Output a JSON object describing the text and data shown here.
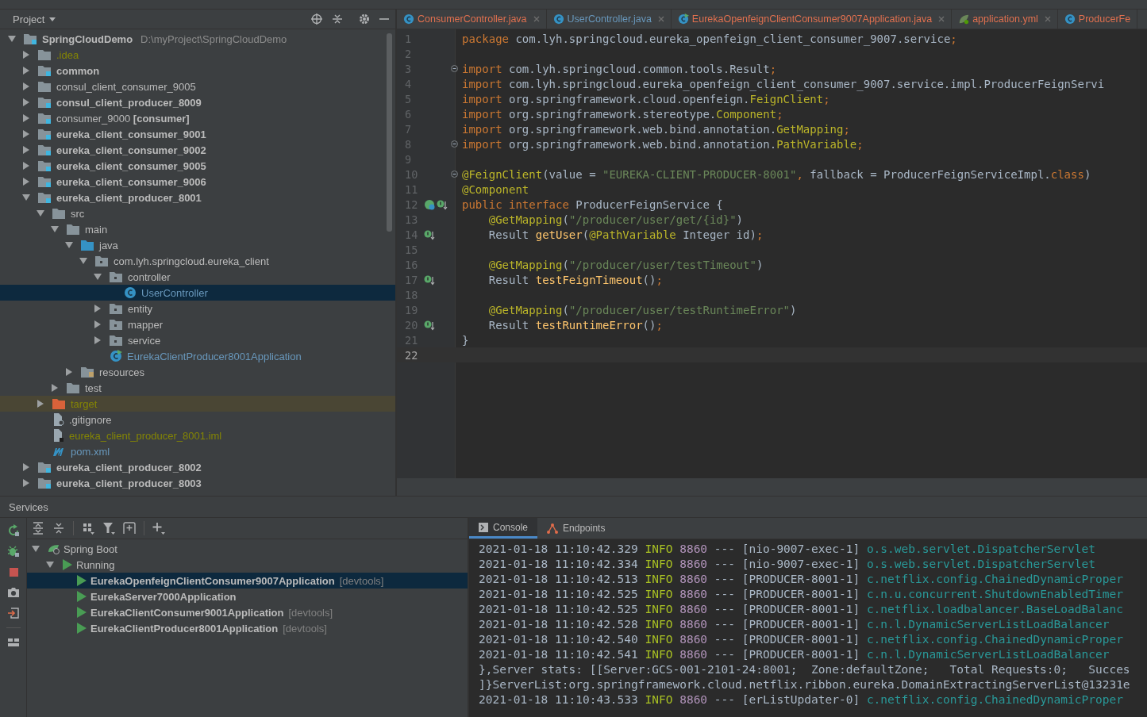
{
  "project_panel": {
    "title": "Project",
    "tree": [
      {
        "name": "SpringCloudDemo",
        "path": "D:\\myProject\\SpringCloudDemo",
        "kind": "module",
        "bold": true,
        "color": "#bbbbbb",
        "expanded": true,
        "selected": false,
        "children": [
          {
            "name": ".idea",
            "kind": "folder",
            "bold": false,
            "color": "#848504",
            "expanded": false,
            "selected": false
          },
          {
            "name": "common",
            "kind": "module",
            "bold": true,
            "color": "#bbbbbb",
            "expanded": false,
            "selected": false
          },
          {
            "name": "consul_client_consumer_9005",
            "kind": "folder",
            "bold": false,
            "color": "#bbbbbb",
            "expanded": false,
            "selected": false
          },
          {
            "name": "consul_client_producer_8009",
            "kind": "module",
            "bold": true,
            "color": "#bbbbbb",
            "expanded": false,
            "selected": false
          },
          {
            "name": "consumer_9000 **[consumer]**",
            "kind": "module",
            "bold": false,
            "color": "#bbbbbb",
            "expanded": false,
            "selected": false
          },
          {
            "name": "eureka_client_consumer_9001",
            "kind": "module",
            "bold": true,
            "color": "#bbbbbb",
            "expanded": false,
            "selected": false
          },
          {
            "name": "eureka_client_consumer_9002",
            "kind": "module",
            "bold": true,
            "color": "#bbbbbb",
            "expanded": false,
            "selected": false
          },
          {
            "name": "eureka_client_consumer_9005",
            "kind": "module",
            "bold": true,
            "color": "#bbbbbb",
            "expanded": false,
            "selected": false
          },
          {
            "name": "eureka_client_consumer_9006",
            "kind": "module",
            "bold": true,
            "color": "#bbbbbb",
            "expanded": false,
            "selected": false
          },
          {
            "name": "eureka_client_producer_8001",
            "kind": "module",
            "bold": true,
            "color": "#bbbbbb",
            "expanded": true,
            "selected": false,
            "children": [
              {
                "name": "src",
                "kind": "folder",
                "bold": false,
                "color": "#bbbbbb",
                "expanded": true,
                "selected": false,
                "children": [
                  {
                    "name": "main",
                    "kind": "folder",
                    "bold": false,
                    "color": "#bbbbbb",
                    "expanded": true,
                    "selected": false,
                    "children": [
                      {
                        "name": "java",
                        "kind": "source-folder",
                        "bold": false,
                        "color": "#bbbbbb",
                        "expanded": true,
                        "selected": false,
                        "children": [
                          {
                            "name": "com.lyh.springcloud.eureka_client",
                            "kind": "package",
                            "bold": false,
                            "color": "#bbbbbb",
                            "expanded": true,
                            "selected": false,
                            "children": [
                              {
                                "name": "controller",
                                "kind": "package",
                                "bold": false,
                                "color": "#bbbbbb",
                                "expanded": true,
                                "selected": false,
                                "children": [
                                  {
                                    "name": "UserController",
                                    "kind": "class",
                                    "bold": false,
                                    "color": "#6897bb",
                                    "selected": true
                                  }
                                ]
                              },
                              {
                                "name": "entity",
                                "kind": "package",
                                "bold": false,
                                "color": "#bbbbbb",
                                "expanded": false,
                                "selected": false
                              },
                              {
                                "name": "mapper",
                                "kind": "package",
                                "bold": false,
                                "color": "#bbbbbb",
                                "expanded": false,
                                "selected": false
                              },
                              {
                                "name": "service",
                                "kind": "package",
                                "bold": false,
                                "color": "#bbbbbb",
                                "expanded": false,
                                "selected": false
                              },
                              {
                                "name": "EurekaClientProducer8001Application",
                                "kind": "app-class",
                                "bold": false,
                                "color": "#6897bb",
                                "selected": false
                              }
                            ]
                          }
                        ]
                      },
                      {
                        "name": "resources",
                        "kind": "resource-folder",
                        "bold": false,
                        "color": "#bbbbbb",
                        "expanded": false,
                        "selected": false
                      }
                    ]
                  },
                  {
                    "name": "test",
                    "kind": "folder",
                    "bold": false,
                    "color": "#bbbbbb",
                    "expanded": false,
                    "selected": false
                  }
                ]
              },
              {
                "name": "target",
                "kind": "excluded-folder",
                "bold": false,
                "color": "#848504",
                "expanded": false,
                "selected": false
              },
              {
                "name": ".gitignore",
                "kind": "ignore-file",
                "bold": false,
                "color": "#bbbbbb",
                "selected": false
              },
              {
                "name": "eureka_client_producer_8001.iml",
                "kind": "module-file",
                "bold": false,
                "color": "#848504",
                "selected": false
              },
              {
                "name": "pom.xml",
                "kind": "maven-file",
                "bold": false,
                "color": "#6897bb",
                "selected": false
              }
            ]
          },
          {
            "name": "eureka_client_producer_8002",
            "kind": "module",
            "bold": true,
            "color": "#bbbbbb",
            "expanded": false,
            "selected": false
          },
          {
            "name": "eureka_client_producer_8003",
            "kind": "module",
            "bold": true,
            "color": "#bbbbbb",
            "expanded": false,
            "selected": false
          }
        ]
      }
    ]
  },
  "editor": {
    "tabs": [
      {
        "label": "ConsumerController.java",
        "kind": "class",
        "color": "#e0704f",
        "closable": true
      },
      {
        "label": "UserController.java",
        "kind": "class",
        "color": "#6897bb",
        "closable": true
      },
      {
        "label": "EurekaOpenfeignClientConsumer9007Application.java",
        "kind": "app-class",
        "color": "#e0704f",
        "closable": true
      },
      {
        "label": "application.yml",
        "kind": "yml",
        "color": "#e0704f",
        "closable": true
      },
      {
        "label": "ProducerFe",
        "kind": "class",
        "color": "#e0704f",
        "closable": false
      }
    ],
    "lines": [
      {
        "num": "1",
        "fold": false,
        "kind": "plain",
        "current": false,
        "tokens": [
          {
            "kind": "kw",
            "text": "package"
          },
          {
            "kind": "p",
            "text": " com.lyh.springcloud.eureka_openfeign_client_consumer_9007.service"
          },
          {
            "kind": "kw",
            "text": ";"
          }
        ]
      },
      {
        "num": "2",
        "fold": false,
        "kind": "plain",
        "current": false
      },
      {
        "num": "3",
        "fold": true,
        "kind": "plain",
        "current": false,
        "tokens": [
          {
            "kind": "kw",
            "text": "import"
          },
          {
            "kind": "p",
            "text": " com.lyh.springcloud.common.tools.Result"
          },
          {
            "kind": "kw",
            "text": ";"
          }
        ]
      },
      {
        "num": "4",
        "fold": false,
        "kind": "plain",
        "current": false,
        "tokens": [
          {
            "kind": "kw",
            "text": "import"
          },
          {
            "kind": "p",
            "text": " com.lyh.springcloud.eureka_openfeign_client_consumer_9007.service.impl.ProducerFeignServi"
          }
        ]
      },
      {
        "num": "5",
        "fold": false,
        "kind": "plain",
        "current": false,
        "tokens": [
          {
            "kind": "kw",
            "text": "import"
          },
          {
            "kind": "p",
            "text": " org.springframework.cloud.openfeign."
          },
          {
            "kind": "ann",
            "text": "FeignClient"
          },
          {
            "kind": "kw",
            "text": ";"
          }
        ]
      },
      {
        "num": "6",
        "fold": false,
        "kind": "plain",
        "current": false,
        "tokens": [
          {
            "kind": "kw",
            "text": "import"
          },
          {
            "kind": "p",
            "text": " org.springframework.stereotype."
          },
          {
            "kind": "ann",
            "text": "Component"
          },
          {
            "kind": "kw",
            "text": ";"
          }
        ]
      },
      {
        "num": "7",
        "fold": false,
        "kind": "plain",
        "current": false,
        "tokens": [
          {
            "kind": "kw",
            "text": "import"
          },
          {
            "kind": "p",
            "text": " org.springframework.web.bind.annotation."
          },
          {
            "kind": "ann",
            "text": "GetMapping"
          },
          {
            "kind": "kw",
            "text": ";"
          }
        ]
      },
      {
        "num": "8",
        "fold": true,
        "kind": "plain",
        "current": false,
        "tokens": [
          {
            "kind": "kw",
            "text": "import"
          },
          {
            "kind": "p",
            "text": " org.springframework.web.bind.annotation."
          },
          {
            "kind": "ann",
            "text": "PathVariable"
          },
          {
            "kind": "kw",
            "text": ";"
          }
        ]
      },
      {
        "num": "9",
        "fold": false,
        "kind": "plain",
        "current": false
      },
      {
        "num": "10",
        "fold": true,
        "kind": "plain",
        "current": false,
        "tokens": [
          {
            "kind": "ann",
            "text": "@FeignClient"
          },
          {
            "kind": "p",
            "text": "(value = "
          },
          {
            "kind": "str",
            "text": "\"EUREKA-CLIENT-PRODUCER-8001\""
          },
          {
            "kind": "kw",
            "text": ", "
          },
          {
            "kind": "p",
            "text": "fallback = ProducerFeignServiceImpl."
          },
          {
            "kind": "kw",
            "text": "class"
          },
          {
            "kind": "p",
            "text": ")"
          }
        ]
      },
      {
        "num": "11",
        "fold": false,
        "kind": "plain",
        "current": false,
        "tokens": [
          {
            "kind": "ann",
            "text": "@Component"
          }
        ]
      },
      {
        "num": "12",
        "fold": false,
        "kind": "interface",
        "current": false,
        "tokens": [
          {
            "kind": "kw",
            "text": "public interface"
          },
          {
            "kind": "p",
            "text": " ProducerFeignService {"
          }
        ]
      },
      {
        "num": "13",
        "fold": false,
        "kind": "plain",
        "current": false,
        "tokens": [
          {
            "kind": "ann",
            "text": "    @GetMapping"
          },
          {
            "kind": "p",
            "text": "("
          },
          {
            "kind": "str",
            "text": "\"/producer/user/get/{id}\""
          },
          {
            "kind": "p",
            "text": ")"
          }
        ]
      },
      {
        "num": "14",
        "fold": false,
        "kind": "method",
        "current": false,
        "tokens": [
          {
            "kind": "p",
            "text": "    Result "
          },
          {
            "kind": "fn",
            "text": "getUser"
          },
          {
            "kind": "p",
            "text": "("
          },
          {
            "kind": "ann",
            "text": "@PathVariable"
          },
          {
            "kind": "p",
            "text": " Integer id)"
          },
          {
            "kind": "kw",
            "text": ";"
          }
        ]
      },
      {
        "num": "15",
        "fold": false,
        "kind": "plain",
        "current": false
      },
      {
        "num": "16",
        "fold": false,
        "kind": "plain",
        "current": false,
        "tokens": [
          {
            "kind": "ann",
            "text": "    @GetMapping"
          },
          {
            "kind": "p",
            "text": "("
          },
          {
            "kind": "str",
            "text": "\"/producer/user/testTimeout\""
          },
          {
            "kind": "p",
            "text": ")"
          }
        ]
      },
      {
        "num": "17",
        "fold": false,
        "kind": "method",
        "current": false,
        "tokens": [
          {
            "kind": "p",
            "text": "    Result "
          },
          {
            "kind": "fn",
            "text": "testFeignTimeout"
          },
          {
            "kind": "p",
            "text": "()"
          },
          {
            "kind": "kw",
            "text": ";"
          }
        ]
      },
      {
        "num": "18",
        "fold": false,
        "kind": "plain",
        "current": false
      },
      {
        "num": "19",
        "fold": false,
        "kind": "plain",
        "current": false,
        "tokens": [
          {
            "kind": "ann",
            "text": "    @GetMapping"
          },
          {
            "kind": "p",
            "text": "("
          },
          {
            "kind": "str",
            "text": "\"/producer/user/testRuntimeError\""
          },
          {
            "kind": "p",
            "text": ")"
          }
        ]
      },
      {
        "num": "20",
        "fold": false,
        "kind": "method",
        "current": false,
        "tokens": [
          {
            "kind": "p",
            "text": "    Result "
          },
          {
            "kind": "fn",
            "text": "testRuntimeError"
          },
          {
            "kind": "p",
            "text": "()"
          },
          {
            "kind": "kw",
            "text": ";"
          }
        ]
      },
      {
        "num": "21",
        "fold": false,
        "kind": "plain",
        "current": false,
        "tokens": [
          {
            "kind": "p",
            "text": "}"
          }
        ]
      },
      {
        "num": "22",
        "fold": false,
        "kind": "plain",
        "current": true
      }
    ]
  },
  "services": {
    "title": "Services",
    "tree": [
      {
        "name": "Spring Boot",
        "kind": "group",
        "expanded": true,
        "selected": false,
        "children": [
          {
            "name": "Running",
            "kind": "status",
            "expanded": true,
            "selected": false,
            "children": [
              {
                "name": "EurekaOpenfeignClientConsumer9007Application",
                "tag": "[devtools]",
                "kind": "app",
                "selected": true
              },
              {
                "name": "EurekaServer7000Application",
                "kind": "app",
                "selected": false
              },
              {
                "name": "EurekaClientConsumer9001Application",
                "tag": "[devtools]",
                "kind": "app",
                "selected": false
              },
              {
                "name": "EurekaClientProducer8001Application",
                "tag": "[devtools]",
                "kind": "app",
                "selected": false
              }
            ]
          }
        ]
      }
    ]
  },
  "console": {
    "tabs": [
      {
        "label": "Console",
        "kind": "console",
        "selected": true
      },
      {
        "label": "Endpoints",
        "kind": "endpoints",
        "selected": false
      }
    ],
    "lines": [
      {
        "kind": "log",
        "time": "2021-01-18 11:10:42.329",
        "level": "INFO",
        "pid": "8860",
        "sep": "---",
        "thread": "[nio-9007-exec-1]",
        "logger": "o.s.web.servlet.DispatcherServlet"
      },
      {
        "kind": "log",
        "time": "2021-01-18 11:10:42.334",
        "level": "INFO",
        "pid": "8860",
        "sep": "---",
        "thread": "[nio-9007-exec-1]",
        "logger": "o.s.web.servlet.DispatcherServlet"
      },
      {
        "kind": "log",
        "time": "2021-01-18 11:10:42.513",
        "level": "INFO",
        "pid": "8860",
        "sep": "---",
        "thread": "[PRODUCER-8001-1]",
        "logger": "c.netflix.config.ChainedDynamicProper"
      },
      {
        "kind": "log",
        "time": "2021-01-18 11:10:42.525",
        "level": "INFO",
        "pid": "8860",
        "sep": "---",
        "thread": "[PRODUCER-8001-1]",
        "logger": "c.n.u.concurrent.ShutdownEnabledTimer"
      },
      {
        "kind": "log",
        "time": "2021-01-18 11:10:42.525",
        "level": "INFO",
        "pid": "8860",
        "sep": "---",
        "thread": "[PRODUCER-8001-1]",
        "logger": "c.netflix.loadbalancer.BaseLoadBalanc"
      },
      {
        "kind": "log",
        "time": "2021-01-18 11:10:42.528",
        "level": "INFO",
        "pid": "8860",
        "sep": "---",
        "thread": "[PRODUCER-8001-1]",
        "logger": "c.n.l.DynamicServerListLoadBalancer"
      },
      {
        "kind": "log",
        "time": "2021-01-18 11:10:42.540",
        "level": "INFO",
        "pid": "8860",
        "sep": "---",
        "thread": "[PRODUCER-8001-1]",
        "logger": "c.netflix.config.ChainedDynamicProper"
      },
      {
        "kind": "log",
        "time": "2021-01-18 11:10:42.541",
        "level": "INFO",
        "pid": "8860",
        "sep": "---",
        "thread": "[PRODUCER-8001-1]",
        "logger": "c.n.l.DynamicServerListLoadBalancer"
      },
      {
        "kind": "plain",
        "text": "},Server stats: [[Server:GCS-001-2101-24:8001;  Zone:defaultZone;   Total Requests:0;   Succes"
      },
      {
        "kind": "plain",
        "text": "]}ServerList:org.springframework.cloud.netflix.ribbon.eureka.DomainExtractingServerList@13231e"
      },
      {
        "kind": "log",
        "time": "2021-01-18 11:10:43.533",
        "level": "INFO",
        "pid": "8860",
        "sep": "---",
        "thread": "[erListUpdater-0]",
        "logger": "c.netflix.config.ChainedDynamicProper"
      }
    ]
  }
}
